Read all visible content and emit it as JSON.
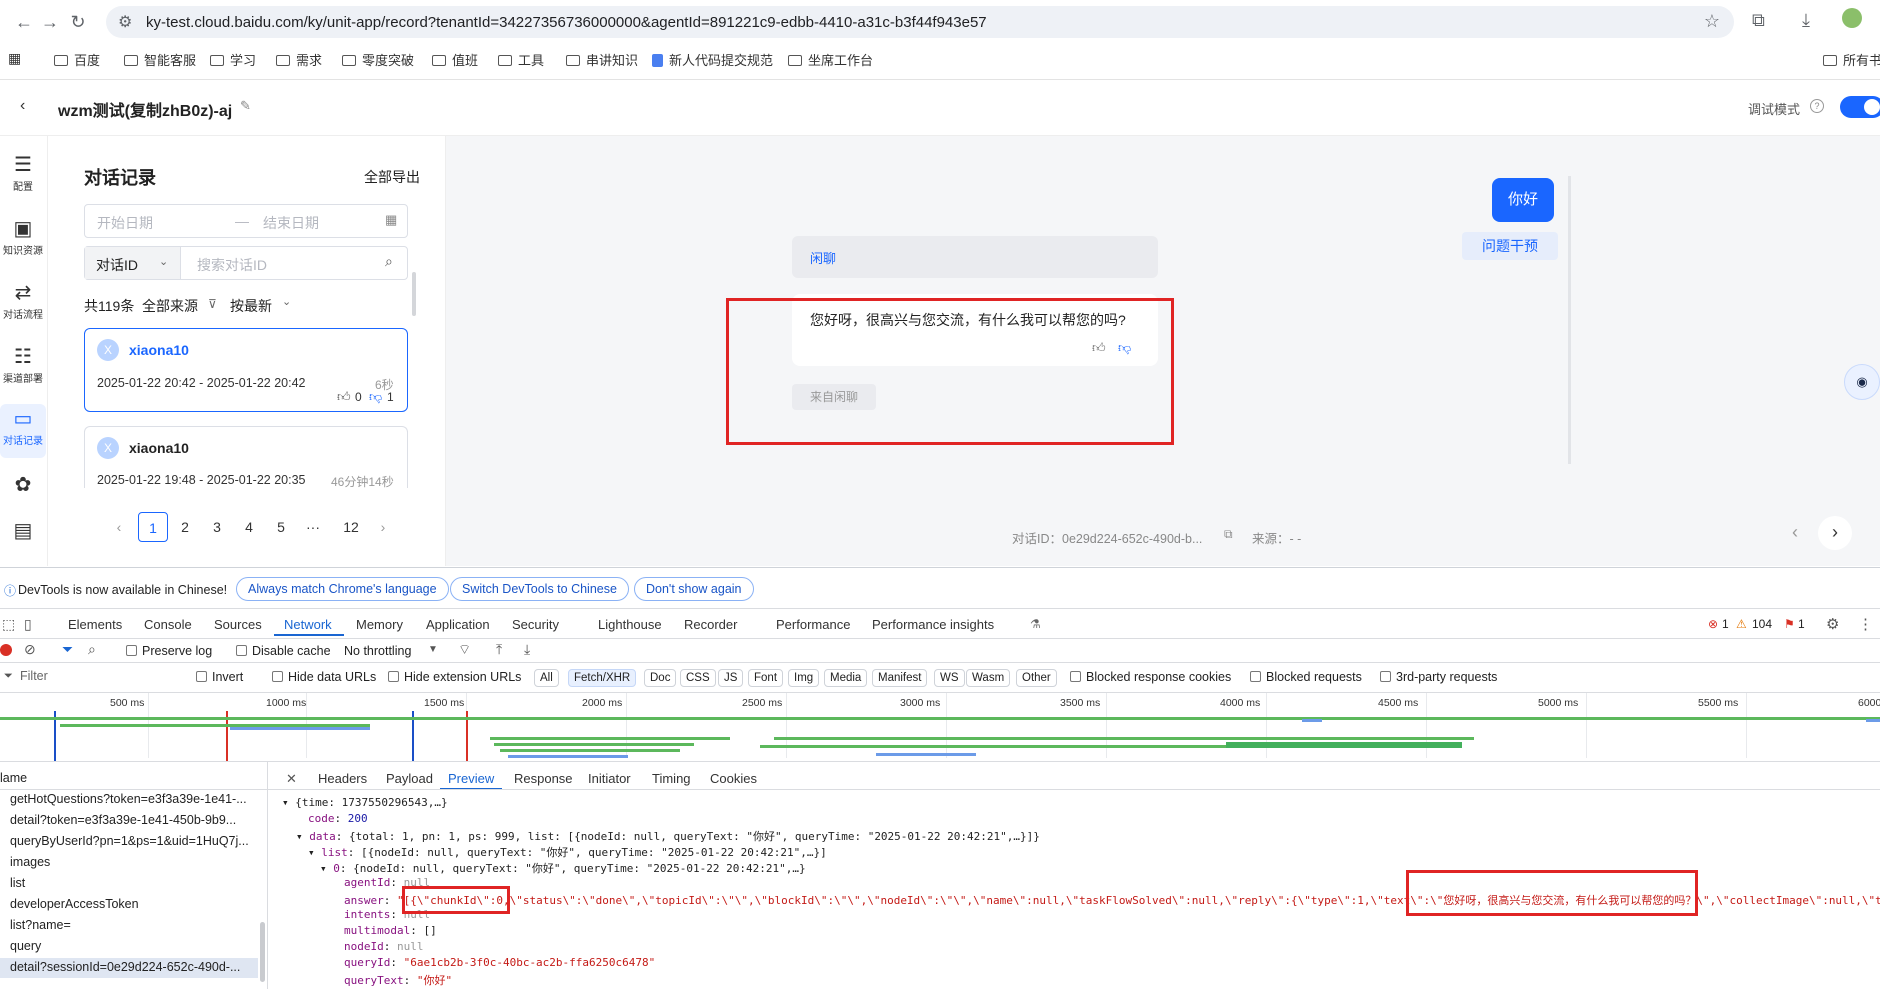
{
  "browser": {
    "url": "ky-test.cloud.baidu.com/ky/unit-app/record?tenantId=34227356736000000&agentId=891221c9-edbb-4410-a31c-b3f44f943e57",
    "bookmarks": [
      "百度",
      "智能客服",
      "学习",
      "需求",
      "零度突破",
      "值班",
      "工具",
      "串讲知识",
      "新人代码提交规范",
      "坐席工作台"
    ],
    "all_bookmarks": "所有书"
  },
  "app": {
    "title": "wzm测试(复制zhB0z)-aj",
    "debug_mode_label": "调试模式",
    "rail": [
      {
        "label": "配置",
        "icon": "sliders-icon"
      },
      {
        "label": "知识资源",
        "icon": "book-icon"
      },
      {
        "label": "对话流程",
        "icon": "flow-icon"
      },
      {
        "label": "渠道部署",
        "icon": "database-icon"
      },
      {
        "label": "对话记录",
        "icon": "chat-icon"
      },
      {
        "label": "",
        "icon": "cluster-icon"
      },
      {
        "label": "",
        "icon": "report-icon"
      }
    ]
  },
  "records": {
    "title": "对话记录",
    "export_all": "全部导出",
    "start_date_placeholder": "开始日期",
    "date_sep": "—",
    "end_date_placeholder": "结束日期",
    "search_type": "对话ID",
    "search_placeholder": "搜索对话ID",
    "total": "共119条",
    "source_filter": "全部来源",
    "sort": "按最新",
    "items": [
      {
        "avatar": "X",
        "name": "xiaona10",
        "time": "2025-01-22 20:42 - 2025-01-22 20:42",
        "duration": "6秒",
        "likes": "0",
        "dislikes": "1"
      },
      {
        "avatar": "X",
        "name": "xiaona10",
        "time": "2025-01-22 19:48 - 2025-01-22 20:35",
        "duration": "46分钟14秒"
      }
    ],
    "pages": [
      "1",
      "2",
      "3",
      "4",
      "5",
      "···",
      "12"
    ]
  },
  "chat": {
    "user_message": "你好",
    "intervene_button": "问题干预",
    "intent_label": "闲聊",
    "bot_reply": "您好呀，很高兴与您交流，有什么我可以帮您的吗?",
    "source_tag": "来自闲聊",
    "conversation_id": "对话ID：0e29d224-652c-490d-b...",
    "source_info": "来源：- -"
  },
  "devtools": {
    "banner": "DevTools is now available in Chinese!",
    "banner_buttons": [
      "Always match Chrome's language",
      "Switch DevTools to Chinese",
      "Don't show again"
    ],
    "tabs": [
      "Elements",
      "Console",
      "Sources",
      "Network",
      "Memory",
      "Application",
      "Security",
      "Lighthouse",
      "Recorder",
      "Performance",
      "Performance insights"
    ],
    "errors": "1",
    "warnings": "104",
    "issues": "1",
    "preserve_log": "Preserve log",
    "disable_cache": "Disable cache",
    "throttling": "No throttling",
    "filter_placeholder": "Filter",
    "invert": "Invert",
    "hide_data_urls": "Hide data URLs",
    "hide_ext_urls": "Hide extension URLs",
    "types": [
      "All",
      "Fetch/XHR",
      "Doc",
      "CSS",
      "JS",
      "Font",
      "Img",
      "Media",
      "Manifest",
      "WS",
      "Wasm",
      "Other"
    ],
    "blocked_cookies": "Blocked response cookies",
    "blocked_requests": "Blocked requests",
    "third_party": "3rd-party requests",
    "ticks": [
      "500 ms",
      "1000 ms",
      "1500 ms",
      "2000 ms",
      "2500 ms",
      "3000 ms",
      "3500 ms",
      "4000 ms",
      "4500 ms",
      "5000 ms",
      "5500 ms",
      "6000"
    ],
    "name_header": "lame",
    "requests": [
      "getHotQuestions?token=e3f3a39e-1e41-...",
      "detail?token=e3f3a39e-1e41-450b-9b9...",
      "queryByUserId?pn=1&ps=1&uid=1HuQ7j...",
      "images",
      "list",
      "developerAccessToken",
      "list?name=",
      "query",
      "detail?sessionId=0e29d224-652c-490d-..."
    ],
    "panel_tabs": [
      "Headers",
      "Payload",
      "Preview",
      "Response",
      "Initiator",
      "Timing",
      "Cookies"
    ],
    "preview": {
      "l1": "{time: 1737550296543,…}",
      "code_key": "code",
      "code_val": "200",
      "data_key": "data",
      "data_val": "{total: 1, pn: 1, ps: 999, list: [{nodeId: null, queryText: \"你好\", queryTime: \"2025-01-22 20:42:21\",…}]}",
      "list_key": "list",
      "list_val": "[{nodeId: null, queryText: \"你好\", queryTime: \"2025-01-22 20:42:21\",…}]",
      "item_key": "0",
      "item_val": "{nodeId: null, queryText: \"你好\", queryTime: \"2025-01-22 20:42:21\",…}",
      "agentId_key": "agentId",
      "null_val": "null",
      "answer_key": "answer",
      "answer_val": "\"[{\\\"chunkId\\\":0,\\\"status\\\":\\\"done\\\",\\\"topicId\\\":\\\"\\\",\\\"blockId\\\":\\\"\\\",\\\"nodeId\\\":\\\"\\\",\\\"name\\\":null,\\\"taskFlowSolved\\\":null,\\\"reply\\\":{\\\"type\\\":1,\\\"text\\\":\\\"您好呀，很高兴与您交流，有什么我可以帮您的吗？\\\",\\\"collectImage\\\":null,\\\"t",
      "intents_key": "intents",
      "multimodal_key": "multimodal",
      "multimodal_val": "[]",
      "nodeId_key": "nodeId",
      "queryId_key": "queryId",
      "queryId_val": "\"6ae1cb2b-3f0c-40bc-ac2b-ffa6250c6478\"",
      "queryText_key": "queryText",
      "queryText_val": "\"你好\""
    }
  },
  "colors": {
    "accent": "#1a66ff",
    "highlight": "#e02424"
  }
}
